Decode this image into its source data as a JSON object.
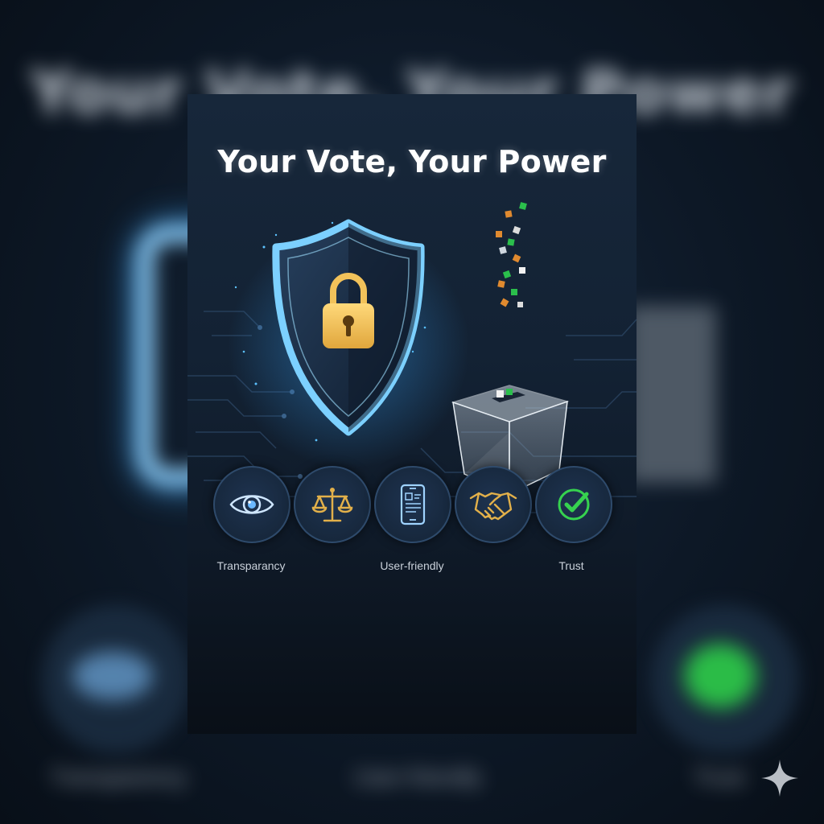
{
  "poster": {
    "title": "Your Vote, Your Power"
  },
  "backdrop": {
    "title": "Your Vote, Your Power",
    "captions": [
      "Transparency",
      "User-friendly",
      "Trust"
    ]
  },
  "features": [
    {
      "icon": "eye-icon",
      "label": "Transparancy"
    },
    {
      "icon": "scales-icon",
      "label": ""
    },
    {
      "icon": "phone-icon",
      "label": "User-friendly"
    },
    {
      "icon": "handshake-icon",
      "label": ""
    },
    {
      "icon": "checkmark-icon",
      "label": "Trust"
    }
  ],
  "colors": {
    "background": "#0b1522",
    "card": "#132234",
    "shield_glow": "#5ec3ff",
    "lock": "#f2c25a",
    "gold_icons": "#e2b04a",
    "check_green": "#36d24f",
    "text": "#ffffff"
  }
}
